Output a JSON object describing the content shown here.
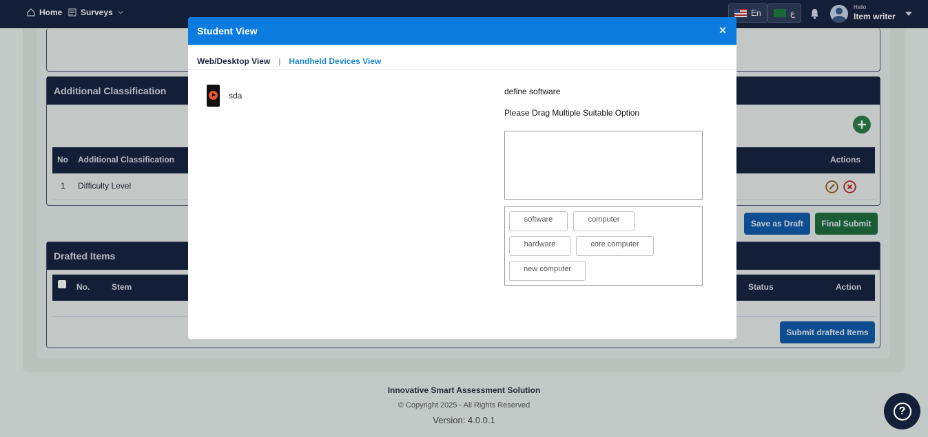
{
  "navbar": {
    "home_label": "Home",
    "surveys_label": "Surveys",
    "lang_en": "En",
    "lang_ar": "ع",
    "user_greeting": "Hello",
    "user_name": "Item writer"
  },
  "page": {
    "classification": {
      "title": "Additional Classification",
      "columns": [
        "No",
        "Additional Classification",
        "Actions"
      ],
      "rows": [
        {
          "no": "1",
          "name": "Difficulty Level"
        }
      ]
    },
    "buttons": {
      "save_draft": "Save as Draft",
      "final_submit": "Final Submit",
      "submit_drafted": "Submit drafted Items"
    },
    "drafted": {
      "title": "Drafted Items",
      "columns": [
        "No.",
        "Stem",
        "Status",
        "Action"
      ]
    },
    "footer": {
      "title": "Innovative Smart Assessment Solution",
      "copyright": "© Copyright 2025 - All Rights Reserved",
      "version": "Version: 4.0.0.1"
    }
  },
  "modal": {
    "title": "Student View",
    "close_label": "×",
    "tab_desktop": "Web/Desktop View",
    "tab_separator": "|",
    "tab_handheld": "Handheld Devices View",
    "media_label": "sda",
    "question": "define software",
    "instruction": "Please Drag Multiple Suitable Option",
    "options": [
      "software",
      "computer",
      "hardware",
      "core computer",
      "new computer"
    ]
  },
  "colors": {
    "navbar": "#13203a",
    "modal_header": "#0b7be0",
    "link": "#1a86d6",
    "primary_button": "#0d5aa8",
    "success_button": "#1a6b3a"
  }
}
